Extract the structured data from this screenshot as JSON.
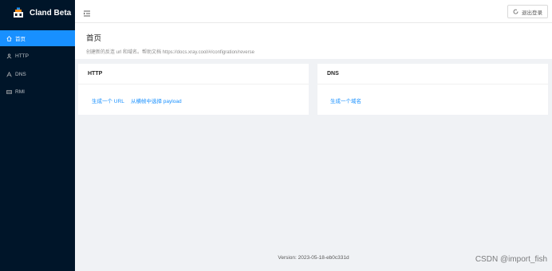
{
  "app": {
    "title": "Cland Beta"
  },
  "sidebar": {
    "items": [
      {
        "label": "首页",
        "icon": "home-icon",
        "active": true
      },
      {
        "label": "HTTP",
        "icon": "http-icon",
        "active": false
      },
      {
        "label": "DNS",
        "icon": "dns-icon",
        "active": false
      },
      {
        "label": "RMI",
        "icon": "rmi-icon",
        "active": false
      }
    ]
  },
  "header": {
    "logout_label": "退出登录"
  },
  "page": {
    "title": "首页",
    "description": "创建新的反连 url 和域名。帮助文档 https://docs.xray.cool/#/configration/reverse"
  },
  "cards": {
    "http": {
      "title": "HTTP",
      "links": [
        "生成一个 URL",
        "从横帧中选择 payload"
      ]
    },
    "dns": {
      "title": "DNS",
      "links": [
        "生成一个域名"
      ]
    }
  },
  "footer": {
    "version": "Version: 2023-05-18-eb0c331d"
  },
  "watermark": "CSDN @import_fish",
  "colors": {
    "sidebar_bg": "#001529",
    "accent": "#1890ff",
    "page_bg": "#f0f2f5"
  }
}
